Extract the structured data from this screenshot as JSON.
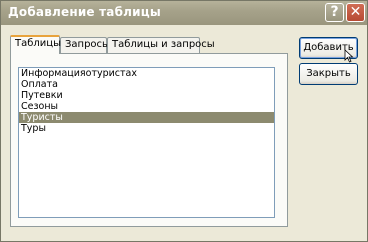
{
  "window": {
    "title": "Добавление таблицы"
  },
  "titlebar": {
    "help_glyph": "?",
    "close_glyph": "✕"
  },
  "tabs": [
    {
      "label": "Таблицы",
      "active": true
    },
    {
      "label": "Запросы",
      "active": false
    },
    {
      "label": "Таблицы и запросы",
      "active": false
    }
  ],
  "list": {
    "items": [
      {
        "label": "Информацияотуристах",
        "selected": false
      },
      {
        "label": "Оплата",
        "selected": false
      },
      {
        "label": "Путевки",
        "selected": false
      },
      {
        "label": "Сезоны",
        "selected": false
      },
      {
        "label": "Туристы",
        "selected": true
      },
      {
        "label": "Туры",
        "selected": false
      }
    ]
  },
  "buttons": {
    "add_label": "Добавить",
    "close_label": "Закрыть"
  },
  "colors": {
    "selection": "#8c8a6f",
    "tab_accent": "#e8a33c",
    "close_button": "#c45a43"
  }
}
